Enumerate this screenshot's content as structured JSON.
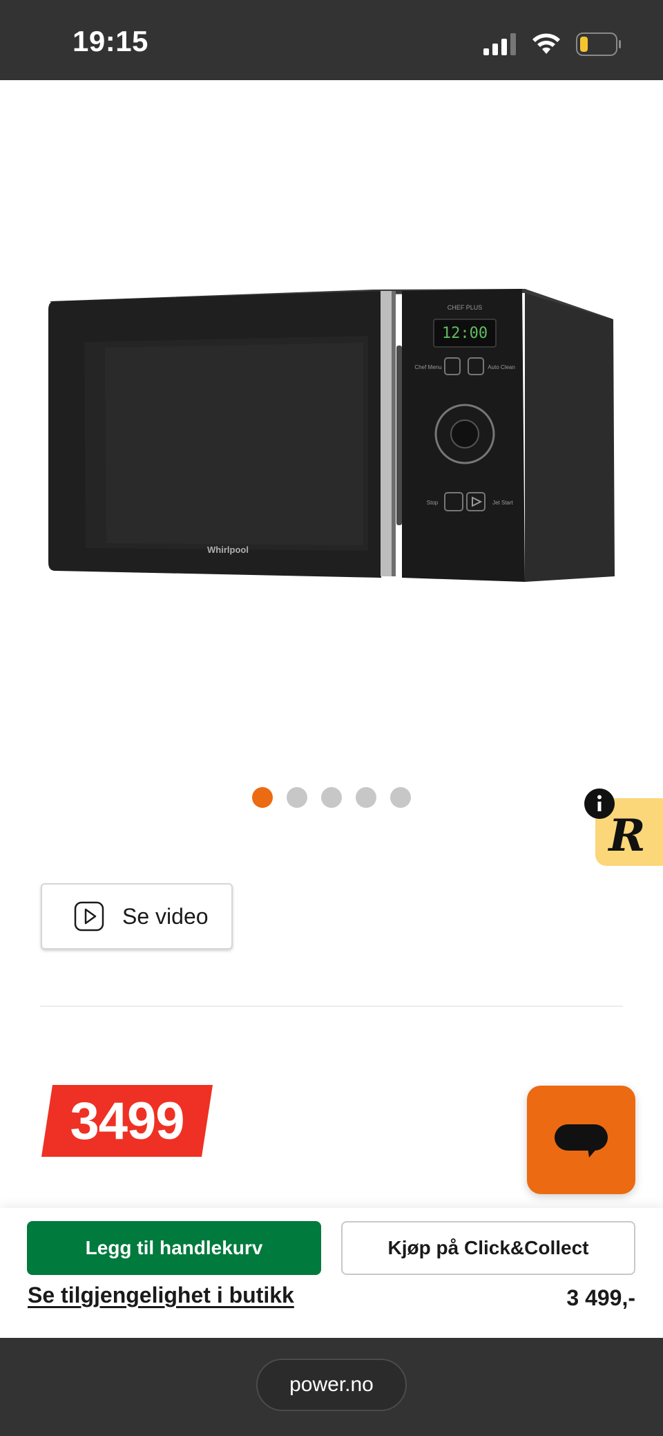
{
  "status_bar": {
    "time": "19:15",
    "battery_color": "#f4c430"
  },
  "product": {
    "image_alt": "Whirlpool microwave",
    "image_dots": [
      true,
      false,
      false,
      false,
      false
    ],
    "display_time": "12:00",
    "panel_labels": {
      "chef_plus": "CHEF PLUS",
      "chef_menu": "Chef Menu",
      "auto_clean": "Auto Clean",
      "stop": "Stop",
      "jet_start": "Jet Start"
    },
    "brand": "Whirlpool"
  },
  "video_button": {
    "label": "Se video",
    "icon": "play-icon"
  },
  "price_tag": {
    "value": "3499",
    "color": "#ee3124"
  },
  "chat_button": {
    "icon": "chat-bubble-icon",
    "color": "#ec6a12"
  },
  "bottom_bar": {
    "add_to_cart": "Legg til handlekurv",
    "click_collect": "Kjøp på Click&Collect",
    "availability_link": "Se tilgjengelighet i butikk",
    "price": "3 499,-"
  },
  "browser": {
    "url": "power.no"
  },
  "colors": {
    "accent_orange": "#ec6a12",
    "cart_green": "#007a3d",
    "price_red": "#ee3124"
  }
}
